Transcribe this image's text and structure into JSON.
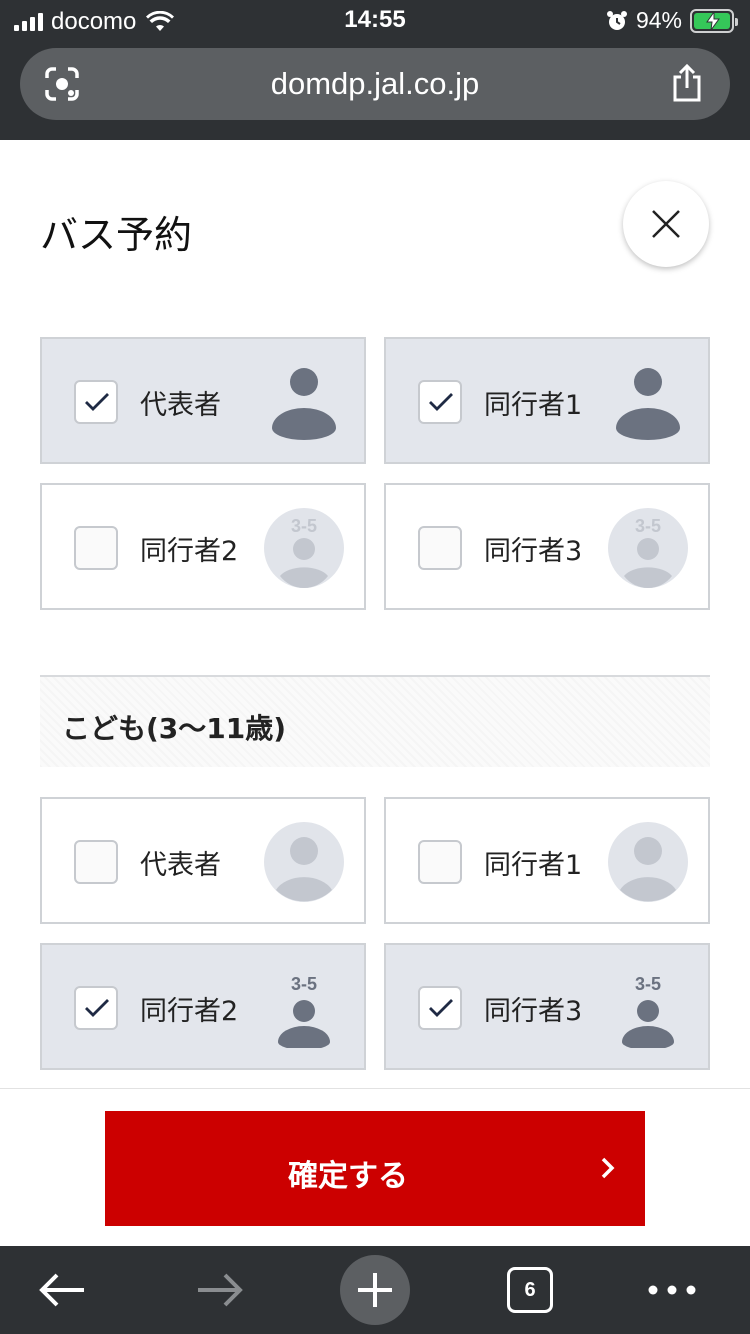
{
  "status_bar": {
    "carrier": "docomo",
    "time": "14:55",
    "battery": "94%",
    "battery_level": 0.94
  },
  "browser": {
    "url": "domdp.jal.co.jp",
    "tab_count": "6"
  },
  "page": {
    "title": "バス予約"
  },
  "adults": [
    {
      "label": "代表者",
      "checked": true,
      "avatar": "person-dark",
      "badge": ""
    },
    {
      "label": "同行者1",
      "checked": true,
      "avatar": "person-dark",
      "badge": ""
    },
    {
      "label": "同行者2",
      "checked": false,
      "avatar": "person-light-circle",
      "badge": "3-5"
    },
    {
      "label": "同行者3",
      "checked": false,
      "avatar": "person-light-circle",
      "badge": "3-5"
    }
  ],
  "children_section": {
    "title": "こども(3〜11歳)"
  },
  "children": [
    {
      "label": "代表者",
      "checked": false,
      "avatar": "person-light-circle",
      "badge": ""
    },
    {
      "label": "同行者1",
      "checked": false,
      "avatar": "person-light-circle",
      "badge": ""
    },
    {
      "label": "同行者2",
      "checked": true,
      "avatar": "person-dark-small",
      "badge": "3-5"
    },
    {
      "label": "同行者3",
      "checked": true,
      "avatar": "person-dark-small",
      "badge": "3-5"
    }
  ],
  "confirm": {
    "label": "確定する"
  },
  "colors": {
    "accent": "#cc0000",
    "checked_card": "#e3e6ec",
    "chrome": "#2e3134"
  }
}
